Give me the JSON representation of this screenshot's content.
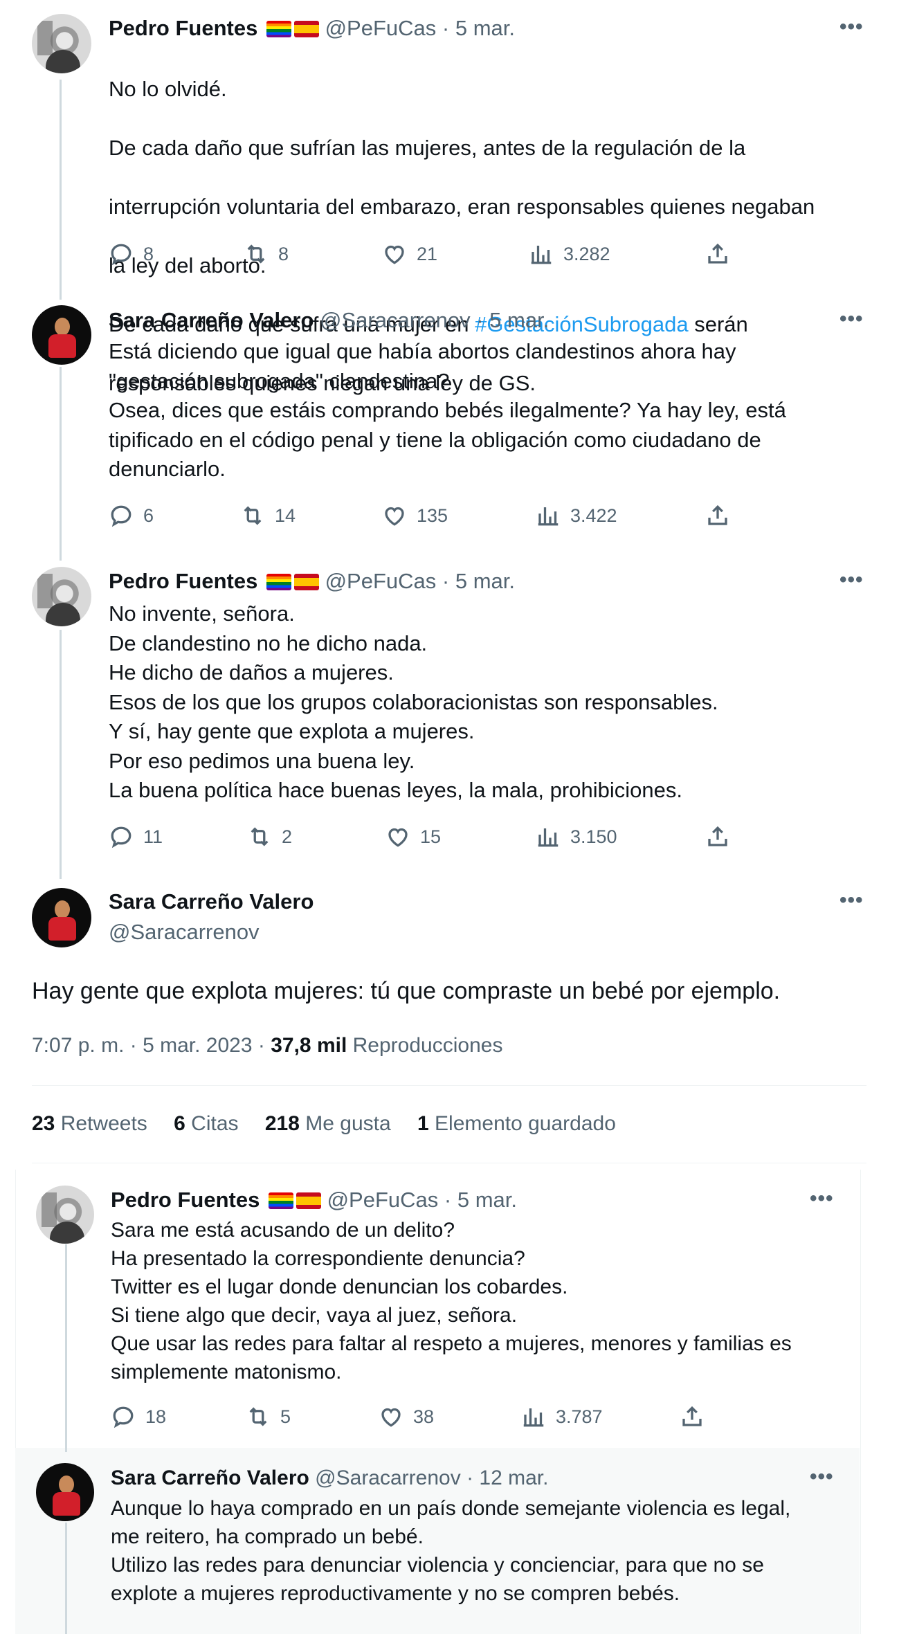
{
  "tweets": [
    {
      "name": "Pedro Fuentes",
      "flags": [
        "rainbow-flag",
        "spain-flag"
      ],
      "handle": "@PeFuCas",
      "date": "5 mar.",
      "lines": [
        "No lo olvidé.",
        "De cada daño que sufrían las mujeres, antes de la regulación de la",
        "interrupción voluntaria del embarazo, eran responsables quienes negaban",
        "la ley del aborto.",
        "De cada daño que sufra una mujer en ",
        "responsables quienes niegan una ley de GS."
      ],
      "hashtag": "#GestaciónSubrogada",
      "after_hashtag": " serán",
      "replies": "8",
      "retweets": "8",
      "likes": "21",
      "views": "3.282"
    },
    {
      "name": "Sara Carreño Valero",
      "handle": "@Saracarrenov",
      "date": "5 mar.",
      "text": "Está diciendo que igual que había abortos clandestinos ahora hay\n\"gestación subrogada\" clandestina?\nOsea, dices que estáis comprando bebés ilegalmente? Ya hay ley, está\ntipificado en el código penal y tiene la obligación como ciudadano de\ndenunciarlo.",
      "replies": "6",
      "retweets": "14",
      "likes": "135",
      "views": "3.422"
    },
    {
      "name": "Pedro Fuentes",
      "flags": [
        "rainbow-flag",
        "spain-flag"
      ],
      "handle": "@PeFuCas",
      "date": "5 mar.",
      "text": "No invente, señora.\nDe clandestino no he dicho nada.\nHe dicho de daños a mujeres.\nEsos de los que los grupos colaboracionistas son responsables.\nY sí, hay gente que explota a mujeres.\nPor eso pedimos una buena ley.\nLa buena política hace buenas leyes, la mala, prohibiciones.",
      "replies": "11",
      "retweets": "2",
      "likes": "15",
      "views": "3.150"
    }
  ],
  "main_tweet": {
    "name": "Sara Carreño Valero",
    "handle": "@Saracarrenov",
    "text": "Hay gente que explota mujeres: tú que compraste un bebé por ejemplo.",
    "time": "7:07 p. m.",
    "date": "5 mar. 2023",
    "views_count": "37,8 mil",
    "views_label": "Reproducciones",
    "stats": {
      "retweets_count": "23",
      "retweets_label": "Retweets",
      "quotes_count": "6",
      "quotes_label": "Citas",
      "likes_count": "218",
      "likes_label": "Me gusta",
      "saves_count": "1",
      "saves_label": "Elemento guardado"
    }
  },
  "replies": [
    {
      "name": "Pedro Fuentes",
      "flags": [
        "rainbow-flag",
        "spain-flag"
      ],
      "handle": "@PeFuCas",
      "date": "5 mar.",
      "text": "Sara me está acusando de un delito?\nHa presentado la correspondiente denuncia?\nTwitter es el lugar donde denuncian los cobardes.\nSi tiene algo que decir, vaya al juez, señora.\nQue usar las redes para faltar al respeto a mujeres, menores y familias es\nsimplemente matonismo.",
      "replies": "18",
      "retweets": "5",
      "likes": "38",
      "views": "3.787"
    },
    {
      "name": "Sara Carreño Valero",
      "handle": "@Saracarrenov",
      "date": "12 mar.",
      "text": "Aunque lo haya comprado en un país donde semejante violencia es legal,\nme reitero, ha comprado un bebé.\nUtilizo las redes para denunciar violencia y concienciar, para que no se\nexplote a mujeres reproductivamente y no se compren bebés."
    }
  ],
  "separator": "·",
  "more_glyph": "•••",
  "icons": [
    "reply-icon",
    "retweet-icon",
    "like-icon",
    "views-icon",
    "share-icon"
  ],
  "colors": {
    "link": "#1d9bf0",
    "secondary": "#536471",
    "thread_line": "#cfd9de",
    "reply_panel_bg": "#f7f9f9"
  }
}
